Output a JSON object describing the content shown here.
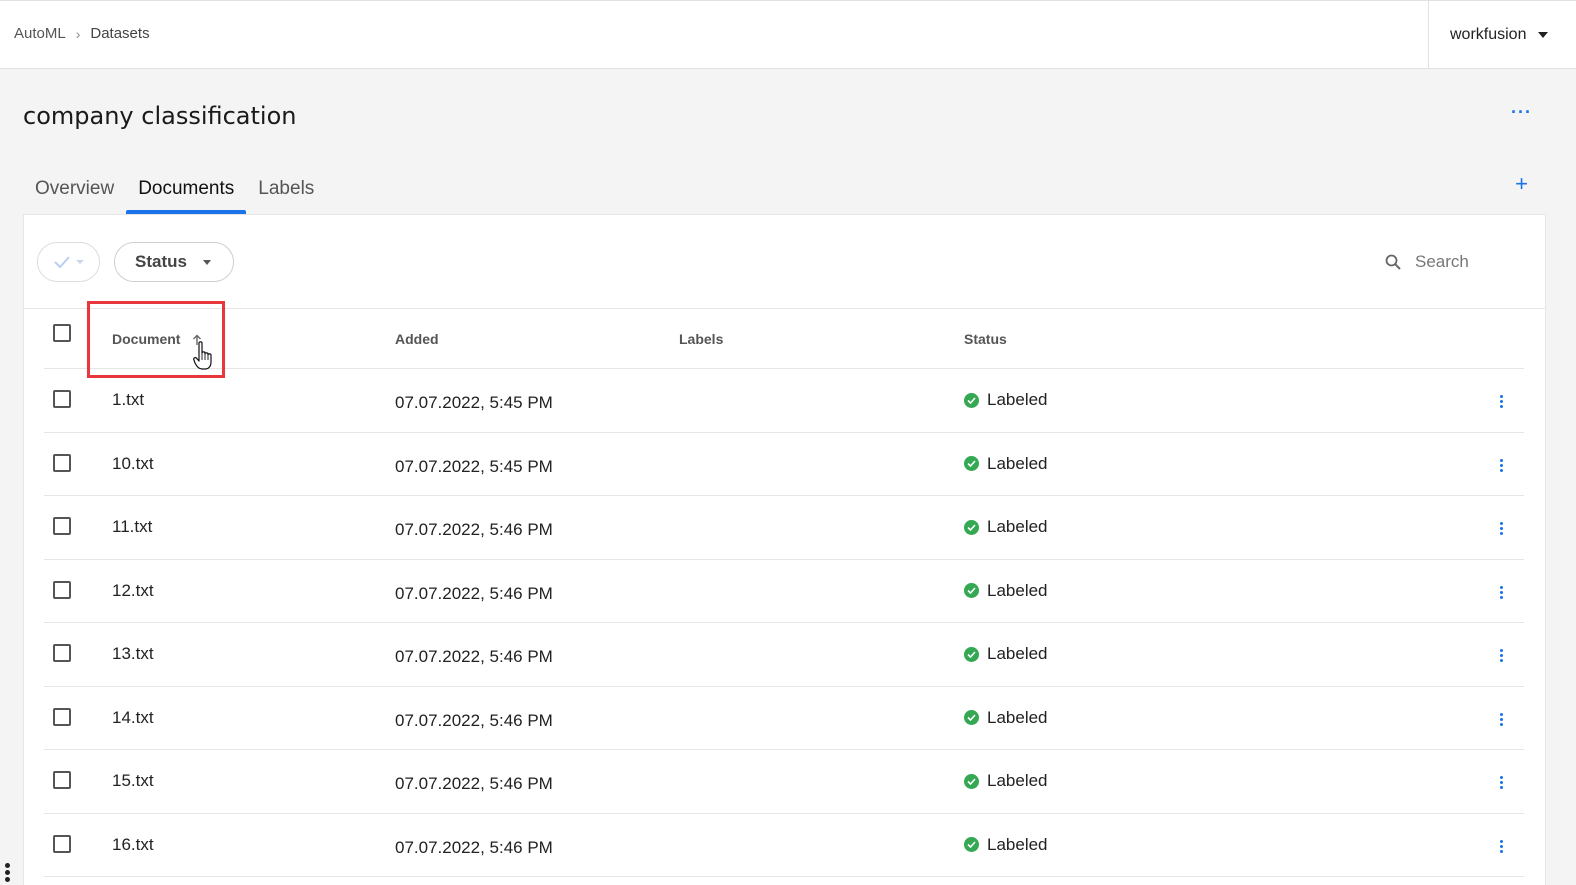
{
  "breadcrumb": {
    "root": "AutoML",
    "current": "Datasets"
  },
  "org": {
    "name": "workfusion"
  },
  "page": {
    "title": "company classification",
    "more_label": "···",
    "add_label": "+"
  },
  "tabs": [
    {
      "label": "Overview",
      "active": false
    },
    {
      "label": "Documents",
      "active": true
    },
    {
      "label": "Labels",
      "active": false
    }
  ],
  "toolbar": {
    "select_icon": "check-icon",
    "status_filter_label": "Status",
    "search_placeholder": "Search"
  },
  "table": {
    "columns": {
      "document": "Document",
      "added": "Added",
      "labels": "Labels",
      "status": "Status"
    },
    "sort": {
      "column": "Document",
      "direction": "ascending"
    },
    "rows": [
      {
        "document": "1.txt",
        "added": "07.07.2022, 5:45 PM",
        "labels": "",
        "status": "Labeled"
      },
      {
        "document": "10.txt",
        "added": "07.07.2022, 5:45 PM",
        "labels": "",
        "status": "Labeled"
      },
      {
        "document": "11.txt",
        "added": "07.07.2022, 5:46 PM",
        "labels": "",
        "status": "Labeled"
      },
      {
        "document": "12.txt",
        "added": "07.07.2022, 5:46 PM",
        "labels": "",
        "status": "Labeled"
      },
      {
        "document": "13.txt",
        "added": "07.07.2022, 5:46 PM",
        "labels": "",
        "status": "Labeled"
      },
      {
        "document": "14.txt",
        "added": "07.07.2022, 5:46 PM",
        "labels": "",
        "status": "Labeled"
      },
      {
        "document": "15.txt",
        "added": "07.07.2022, 5:46 PM",
        "labels": "",
        "status": "Labeled"
      },
      {
        "document": "16.txt",
        "added": "07.07.2022, 5:46 PM",
        "labels": "",
        "status": "Labeled"
      }
    ]
  },
  "colors": {
    "accent": "#1a73e8",
    "status_ok": "#34a853",
    "highlight": "#e8363d"
  }
}
